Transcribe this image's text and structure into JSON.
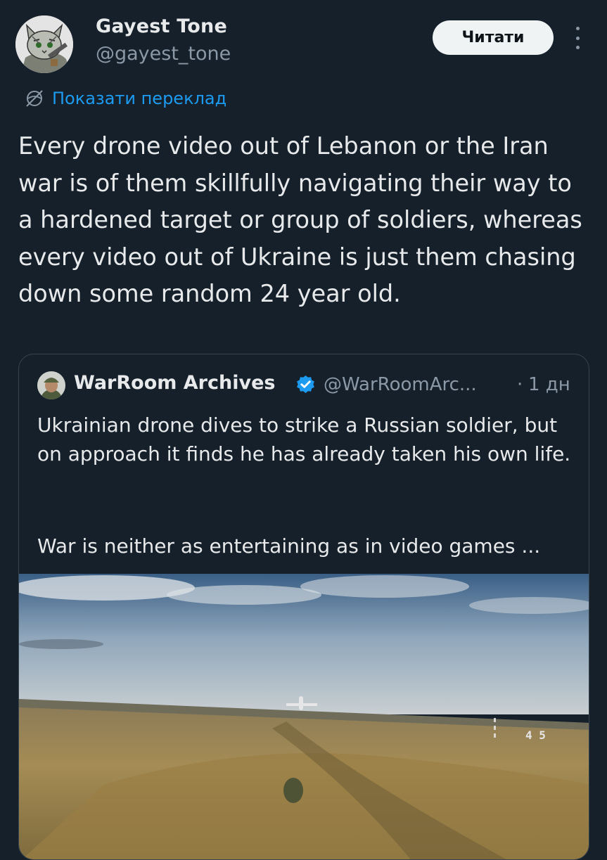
{
  "tweet": {
    "author": {
      "name": "Gayest Tone",
      "handle": "@gayest_tone"
    },
    "follow_label": "Читати",
    "translate_label": "Показати переклад",
    "text": "Every drone video out of Lebanon or the Iran war is of them skillfully navigating their way to a hardened target or group of soldiers, whereas every video out of Ukraine is just them chasing down some random 24 year old."
  },
  "quote": {
    "author": {
      "name": "WarRoom Archives",
      "handle": "@WarRoomArc...",
      "verified": true
    },
    "separator": "·",
    "time": "1 дн",
    "text_p1": "Ukrainian drone dives to strike a Russian soldier, but on approach it finds he has already taken his own life.",
    "text_p2": "War is neither as entertaining as in video games ...",
    "media": {
      "type": "video-thumbnail",
      "hud_text": "4 5"
    }
  },
  "colors": {
    "background": "#15202b",
    "text": "#e7e9ea",
    "secondary": "#8b98a5",
    "link": "#1d9bf0",
    "verified": "#1d9bf0",
    "border": "#38444d",
    "button_bg": "#eff3f4"
  },
  "icons": [
    "more-icon",
    "translate-icon",
    "verified-icon"
  ]
}
